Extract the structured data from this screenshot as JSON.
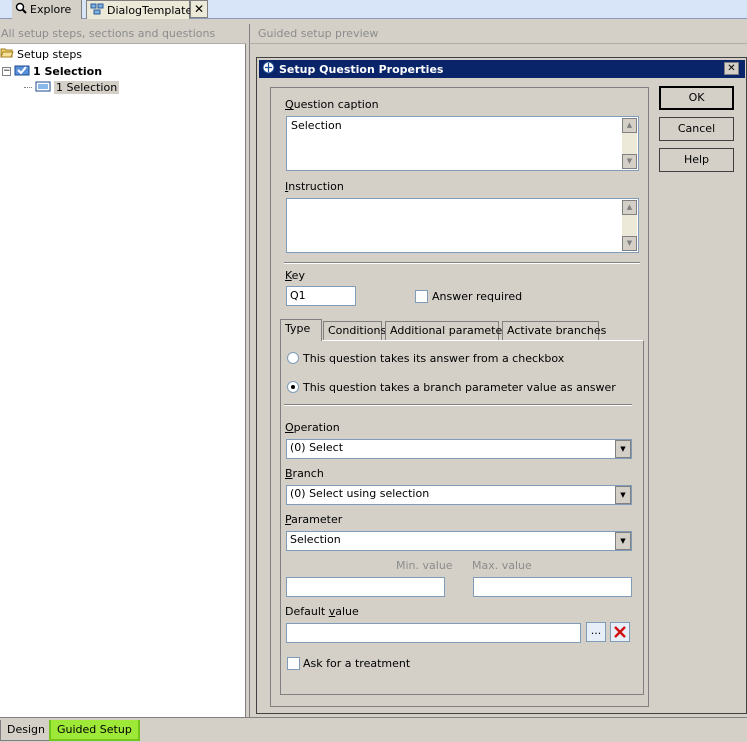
{
  "top_tabs": [
    {
      "label": "Explore",
      "icon": "magnifier-icon"
    },
    {
      "label": "DialogTemplate",
      "icon": "dialog-template-icon"
    }
  ],
  "left_panel": {
    "header": "All setup steps, sections and questions",
    "tree": {
      "root": "Setup steps",
      "step": "1 Selection",
      "question": "1 Selection"
    }
  },
  "right_panel": {
    "header": "Guided setup preview"
  },
  "dialog": {
    "title": "Setup Question Properties",
    "question_caption_label": "Question caption",
    "question_caption_value": "Selection",
    "instruction_label": "Instruction",
    "instruction_value": "",
    "key_label": "Key",
    "key_value": "Q1",
    "answer_required_label": "Answer required",
    "answer_required": false,
    "tabs": [
      "Type",
      "Conditions",
      "Additional parameters",
      "Activate branches"
    ],
    "active_tab": "Type",
    "radio_checkbox_label": "This question takes its answer from a checkbox",
    "radio_branch_label": "This question takes a branch parameter value as answer",
    "selected_radio": "branch",
    "operation_label": "Operation",
    "operation_value": "(0) Select",
    "branch_label": "Branch",
    "branch_value": "(0) Select using selection",
    "parameter_label": "Parameter",
    "parameter_value": "Selection",
    "min_value_label": "Min. value",
    "max_value_label": "Max. value",
    "min_value": "",
    "max_value": "",
    "default_value_label": "Default value",
    "default_value": "",
    "lookup_button": "...",
    "ask_treatment_label": "Ask for a treatment",
    "ask_treatment": false,
    "ok_label": "OK",
    "cancel_label": "Cancel",
    "help_label": "Help"
  },
  "bottom_tabs": [
    "Design",
    "Guided Setup"
  ],
  "colors": {
    "title_bar": "#0a246a",
    "active_bottom_tab": "#9ee838",
    "control_face": "#d4d0c8"
  }
}
